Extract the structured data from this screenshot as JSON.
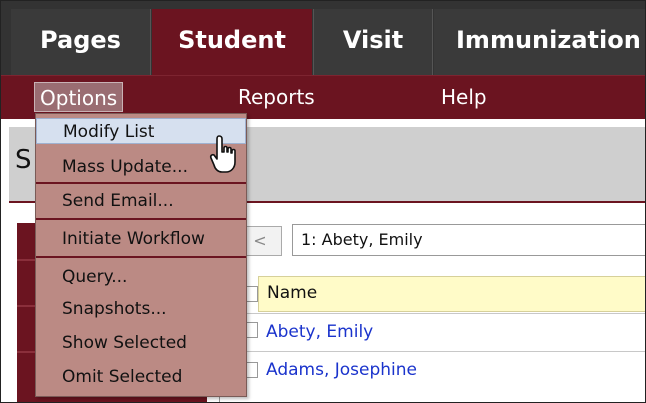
{
  "tabs": [
    {
      "label": "Pages"
    },
    {
      "label": "Student"
    },
    {
      "label": "Visit"
    },
    {
      "label": "Immunization"
    }
  ],
  "menubar": {
    "options": "Options",
    "reports": "Reports",
    "help": "Help"
  },
  "page": {
    "title_initial": "S"
  },
  "options_menu": {
    "items": [
      "Modify List",
      "Mass Update...",
      "Send Email...",
      "Initiate Workflow",
      "Query...",
      "Snapshots...",
      "Show Selected",
      "Omit Selected"
    ],
    "hovered_index": 0
  },
  "list": {
    "nav_prev": "<",
    "current_record": "1: Abety, Emily",
    "column_header": "Name",
    "rows": [
      "Abety, Emily",
      "Adams, Josephine"
    ]
  },
  "colors": {
    "accent": "#6b1420",
    "tabbar": "#333333",
    "menu_bg": "#bb8a84",
    "menu_hover": "#d6e0ef",
    "link": "#1a33cc",
    "header_row": "#fffbc8"
  },
  "cursor": "hand-pointer-icon"
}
